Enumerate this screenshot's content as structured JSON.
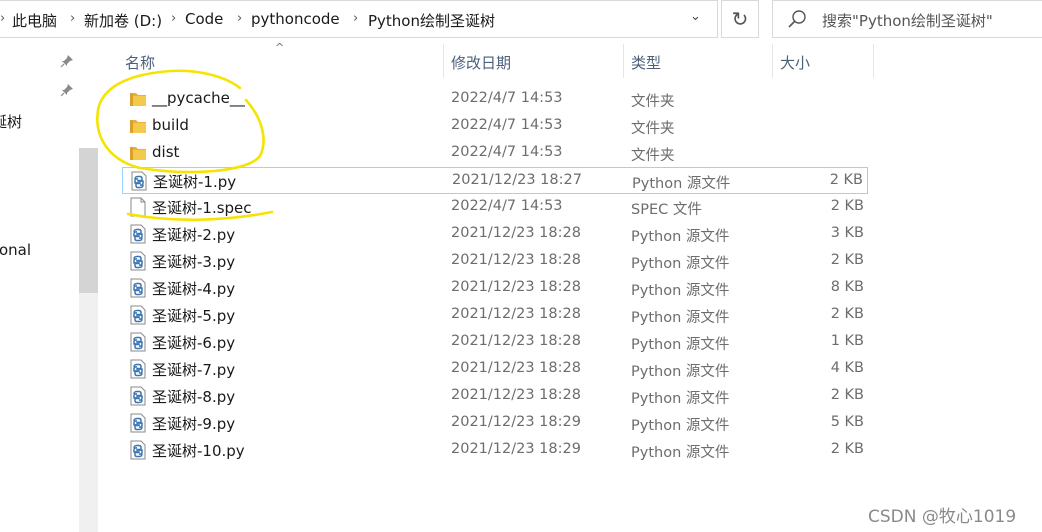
{
  "address_bar": {
    "segments": [
      "此电脑",
      "新加卷 (D:)",
      "Code",
      "pythoncode",
      "Python绘制圣诞树"
    ],
    "separator": "›",
    "dropdown": "⌄"
  },
  "refresh_glyph": "↻",
  "search": {
    "placeholder": "搜索\"Python绘制圣诞树\""
  },
  "nav_pane": {
    "items": [
      "诞树",
      "onal"
    ]
  },
  "columns": {
    "name": "名称",
    "date": "修改日期",
    "type": "类型",
    "size": "大小"
  },
  "files": [
    {
      "name": "__pycache__",
      "date": "2022/4/7 14:53",
      "type": "文件夹",
      "size": "",
      "icon": "folder-icon"
    },
    {
      "name": "build",
      "date": "2022/4/7 14:53",
      "type": "文件夹",
      "size": "",
      "icon": "folder-icon"
    },
    {
      "name": "dist",
      "date": "2022/4/7 14:53",
      "type": "文件夹",
      "size": "",
      "icon": "folder-icon"
    },
    {
      "name": "圣诞树-1.py",
      "date": "2021/12/23 18:27",
      "type": "Python 源文件",
      "size": "2 KB",
      "icon": "python-file-icon",
      "selected": true
    },
    {
      "name": "圣诞树-1.spec",
      "date": "2022/4/7 14:53",
      "type": "SPEC 文件",
      "size": "2 KB",
      "icon": "blank-file-icon"
    },
    {
      "name": "圣诞树-2.py",
      "date": "2021/12/23 18:28",
      "type": "Python 源文件",
      "size": "3 KB",
      "icon": "python-file-icon"
    },
    {
      "name": "圣诞树-3.py",
      "date": "2021/12/23 18:28",
      "type": "Python 源文件",
      "size": "2 KB",
      "icon": "python-file-icon"
    },
    {
      "name": "圣诞树-4.py",
      "date": "2021/12/23 18:28",
      "type": "Python 源文件",
      "size": "8 KB",
      "icon": "python-file-icon"
    },
    {
      "name": "圣诞树-5.py",
      "date": "2021/12/23 18:28",
      "type": "Python 源文件",
      "size": "2 KB",
      "icon": "python-file-icon"
    },
    {
      "name": "圣诞树-6.py",
      "date": "2021/12/23 18:28",
      "type": "Python 源文件",
      "size": "1 KB",
      "icon": "python-file-icon"
    },
    {
      "name": "圣诞树-7.py",
      "date": "2021/12/23 18:28",
      "type": "Python 源文件",
      "size": "4 KB",
      "icon": "python-file-icon"
    },
    {
      "name": "圣诞树-8.py",
      "date": "2021/12/23 18:28",
      "type": "Python 源文件",
      "size": "2 KB",
      "icon": "python-file-icon"
    },
    {
      "name": "圣诞树-9.py",
      "date": "2021/12/23 18:29",
      "type": "Python 源文件",
      "size": "5 KB",
      "icon": "python-file-icon"
    },
    {
      "name": "圣诞树-10.py",
      "date": "2021/12/23 18:29",
      "type": "Python 源文件",
      "size": "2 KB",
      "icon": "python-file-icon"
    }
  ],
  "watermark": "CSDN @牧心1019",
  "colors": {
    "selection_border": "#99d1ff",
    "annotation": "#f5e400",
    "header_text": "#4c607a",
    "folder": "#e8b03a"
  }
}
